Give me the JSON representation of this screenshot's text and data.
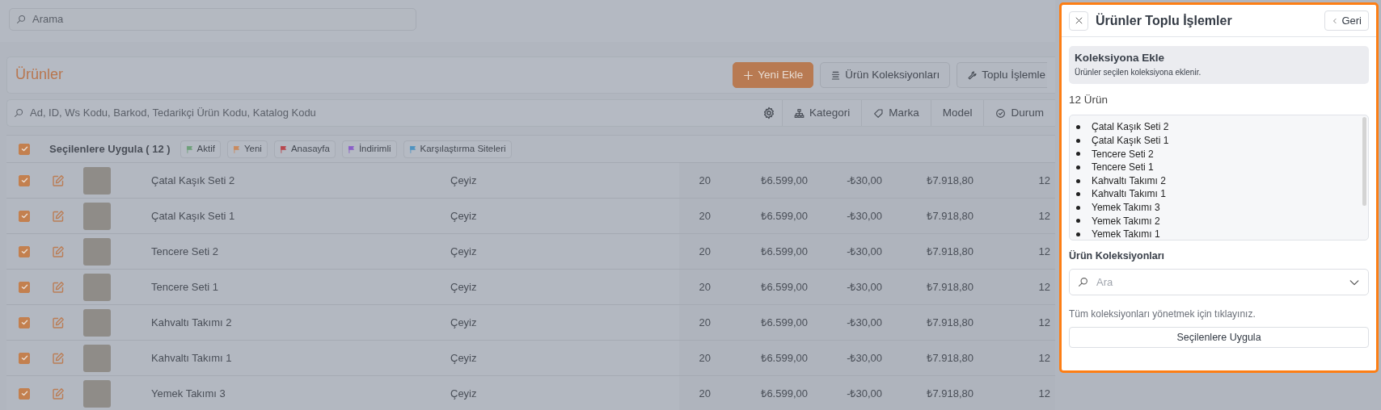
{
  "search": {
    "placeholder": "Arama"
  },
  "page": {
    "title": "Ürünler",
    "actions": [
      {
        "label": "Yeni Ekle",
        "kind": "primary"
      },
      {
        "label": "Ürün Koleksiyonları",
        "kind": "secondary"
      },
      {
        "label": "Toplu İşlemle",
        "kind": "secondary"
      }
    ]
  },
  "filter": {
    "placeholder": "Ad, ID, Ws Kodu, Barkod, Tedarikçi Ürün Kodu, Katalog Kodu",
    "filters": [
      "Kategori",
      "Marka",
      "Model",
      "Durum"
    ]
  },
  "bulk": {
    "checked": true,
    "label": "Seçilenlere Uygula ( 12 )",
    "tags": [
      {
        "label": "Aktif",
        "color": "#6fa07a"
      },
      {
        "label": "Yeni",
        "color": "#c98a5e"
      },
      {
        "label": "Anasayfa",
        "color": "#b8474e"
      },
      {
        "label": "İndirimli",
        "color": "#8a5fc8"
      },
      {
        "label": "Karşılaştırma Siteleri",
        "color": "#4f93c0"
      }
    ]
  },
  "rows": [
    {
      "checked": true,
      "cells": [
        "Çatal Kaşık Seti 2",
        "Çeyiz",
        "20",
        "₺6.599,00",
        "-₺30,00",
        "₺7.918,80",
        "12"
      ]
    },
    {
      "checked": true,
      "cells": [
        "Çatal Kaşık Seti 1",
        "Çeyiz",
        "20",
        "₺6.599,00",
        "-₺30,00",
        "₺7.918,80",
        "12"
      ]
    },
    {
      "checked": true,
      "cells": [
        "Tencere Seti 2",
        "Çeyiz",
        "20",
        "₺6.599,00",
        "-₺30,00",
        "₺7.918,80",
        "12"
      ]
    },
    {
      "checked": true,
      "cells": [
        "Tencere Seti 1",
        "Çeyiz",
        "20",
        "₺6.599,00",
        "-₺30,00",
        "₺7.918,80",
        "12"
      ]
    },
    {
      "checked": true,
      "cells": [
        "Kahvaltı Takımı 2",
        "Çeyiz",
        "20",
        "₺6.599,00",
        "-₺30,00",
        "₺7.918,80",
        "12"
      ]
    },
    {
      "checked": true,
      "cells": [
        "Kahvaltı Takımı 1",
        "Çeyiz",
        "20",
        "₺6.599,00",
        "-₺30,00",
        "₺7.918,80",
        "12"
      ]
    },
    {
      "checked": true,
      "cells": [
        "Yemek Takımı 3",
        "Çeyiz",
        "20",
        "₺6.599,00",
        "-₺30,00",
        "₺7.918,80",
        "12"
      ]
    }
  ],
  "panel": {
    "title": "Ürünler Toplu İşlemler",
    "back": "Geri",
    "info_title": "Koleksiyona Ekle",
    "info_text": "Ürünler seçilen koleksiyona eklenir.",
    "count": "12 Ürün",
    "items": [
      "Çatal Kaşık Seti 2",
      "Çatal Kaşık Seti 1",
      "Tencere Seti 2",
      "Tencere Seti 1",
      "Kahvaltı Takımı 2",
      "Kahvaltı Takımı 1",
      "Yemek Takımı 3",
      "Yemek Takımı 2",
      "Yemek Takımı 1"
    ],
    "field_label": "Ürün Koleksiyonları",
    "select_placeholder": "Ara",
    "help": "Tüm koleksiyonları yönetmek için tıklayınız.",
    "apply": "Seçilenlere Uygula"
  }
}
